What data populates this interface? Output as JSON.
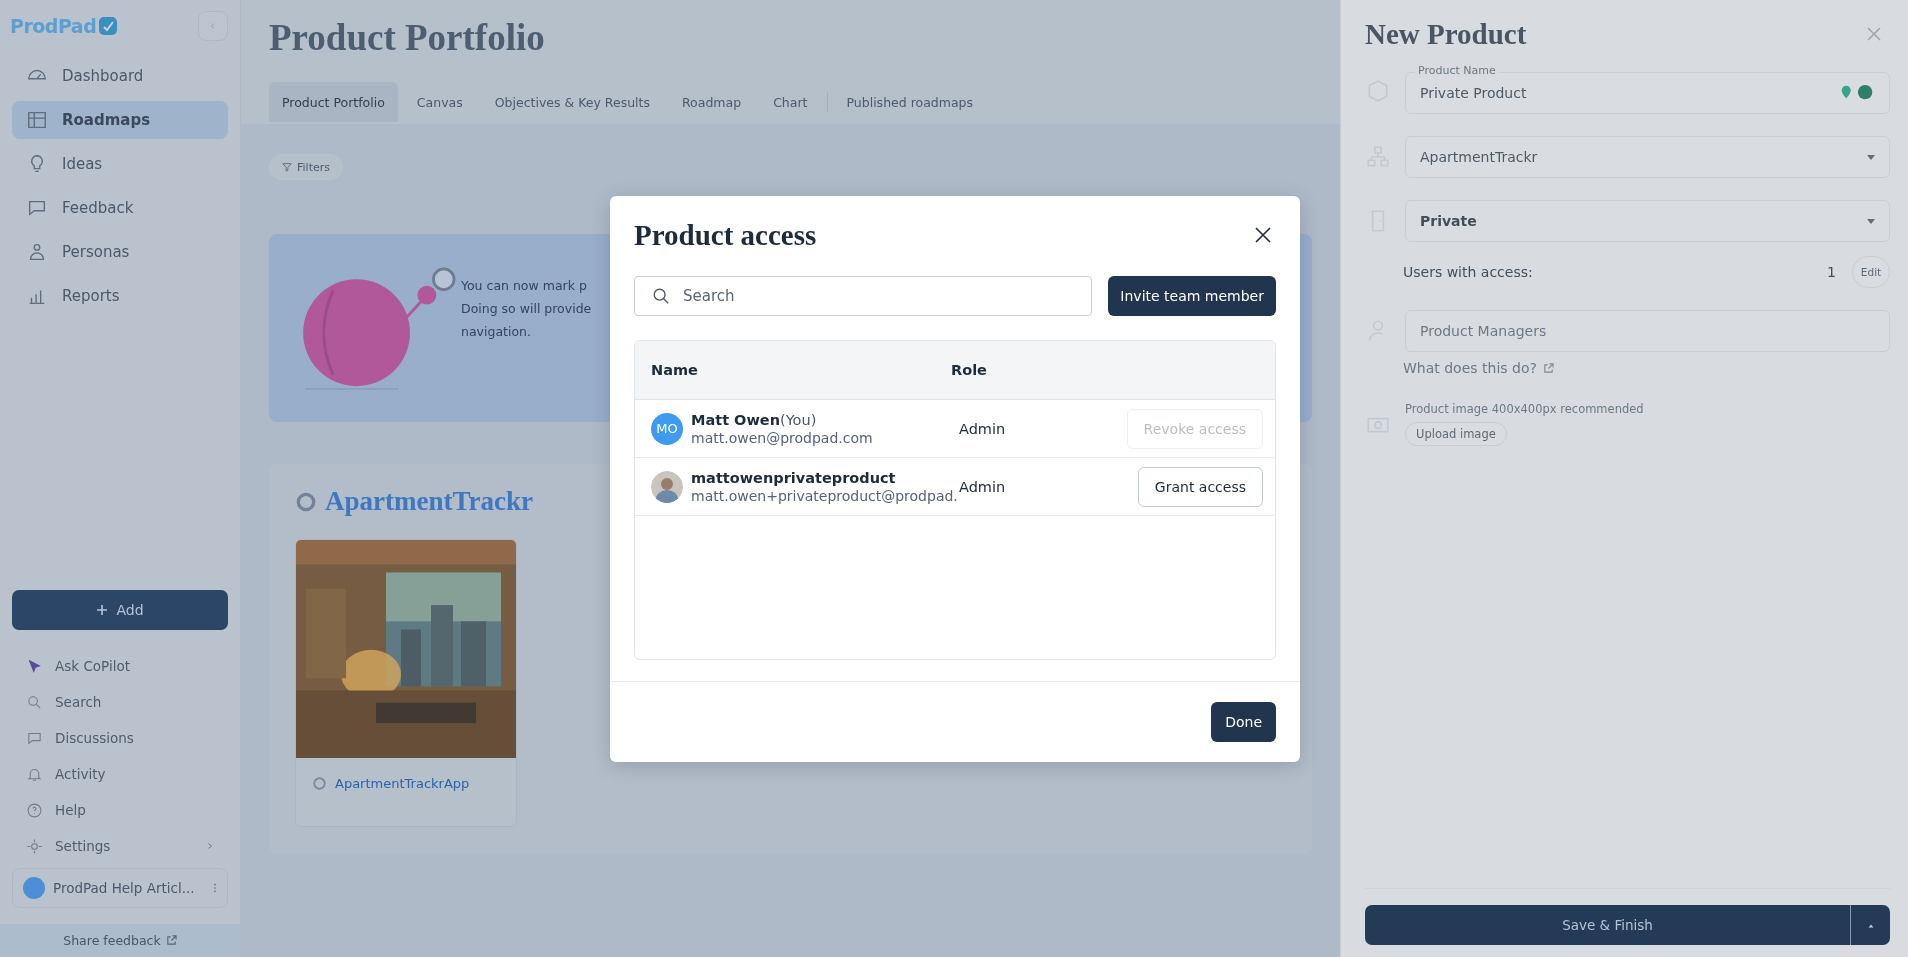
{
  "sidebar": {
    "logo": "ProdPad",
    "nav_items": [
      {
        "label": "Dashboard",
        "selected": false
      },
      {
        "label": "Roadmaps",
        "selected": true
      },
      {
        "label": "Ideas",
        "selected": false
      },
      {
        "label": "Feedback",
        "selected": false
      },
      {
        "label": "Personas",
        "selected": false
      },
      {
        "label": "Reports",
        "selected": false
      }
    ],
    "add_button": "Add",
    "bottom_items": [
      {
        "label": "Ask CoPilot",
        "expandable": false
      },
      {
        "label": "Search",
        "expandable": false
      },
      {
        "label": "Discussions",
        "expandable": false
      },
      {
        "label": "Activity",
        "expandable": false
      },
      {
        "label": "Help",
        "expandable": false
      },
      {
        "label": "Settings",
        "expandable": true
      }
    ],
    "workspace": "ProdPad Help Articl...",
    "share_feedback": "Share feedback"
  },
  "main": {
    "title": "Product Portfolio",
    "tabs": [
      {
        "label": "Product Portfolio",
        "selected": true
      },
      {
        "label": "Canvas",
        "selected": false
      },
      {
        "label": "Objectives & Key Results",
        "selected": false
      },
      {
        "label": "Roadmap",
        "selected": false
      },
      {
        "label": "Chart",
        "selected": false
      },
      {
        "label": "Published roadmaps",
        "selected": false
      }
    ],
    "filters": "Filters",
    "banner_lines": [
      "You can now mark p",
      "Doing so will provide",
      "navigation."
    ],
    "product_line": "ApartmentTrackr",
    "product_card": {
      "kind": "picture",
      "label": "ApartmentTrackrApp"
    }
  },
  "new_product": {
    "title": "New Product",
    "product_name_label": "Product Name",
    "product_name": "Private Product",
    "product_line": "ApartmentTrackr",
    "visibility": "Private",
    "users_label": "Users with access:",
    "users_count": "1",
    "edit_button": "Edit",
    "managers_placeholder": "Product Managers",
    "help_link": "What does this do?",
    "image_hint": "Product image 400x400px recommended",
    "upload_button": "Upload image",
    "save_button": "Save & Finish"
  },
  "modal": {
    "title": "Product access",
    "search": {
      "placeholder": "Search"
    },
    "invite_button": "Invite team member",
    "columns": [
      "Name",
      "Role"
    ],
    "rows": [
      {
        "initials": "MO",
        "name": "Matt Owen",
        "you_tag": "(You)",
        "email": "matt.owen@prodpad.com",
        "role": "Admin",
        "action": "Revoke access",
        "action_disabled": true
      },
      {
        "name": "mattowenprivateproduct",
        "email": "matt.owen+privateproduct@prodpad.",
        "role": "Admin",
        "action": "Grant access",
        "action_disabled": false
      }
    ],
    "done_button": "Done"
  }
}
